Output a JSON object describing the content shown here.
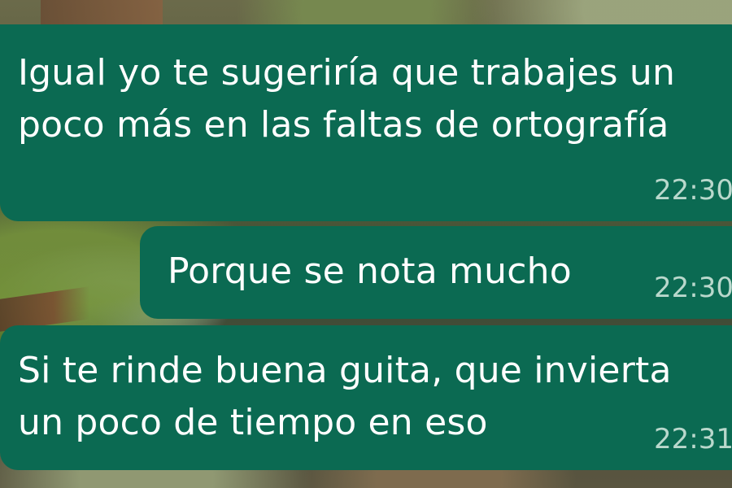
{
  "colors": {
    "bubble": "#0b6a52",
    "text": "#ffffff",
    "timestamp": "#b9d8cc"
  },
  "messages": [
    {
      "text": "Igual yo te sugeriría que trabajes un\npoco más en las faltas de ortografía",
      "time": "22:30"
    },
    {
      "text": "Porque se nota mucho",
      "time": "22:30"
    },
    {
      "text": "Si te rinde buena guita, que invierta\nun poco de tiempo en eso",
      "time": "22:31"
    }
  ]
}
